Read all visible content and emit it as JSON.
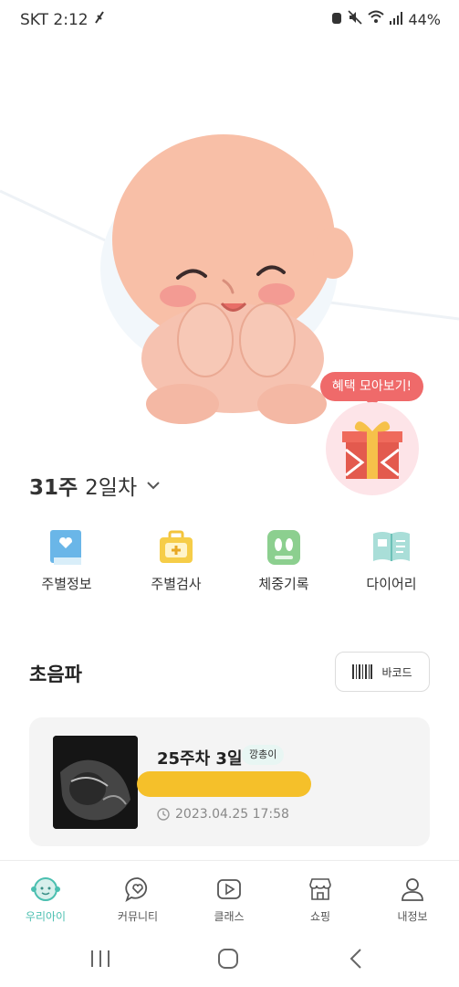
{
  "status_bar": {
    "carrier": "SKT",
    "time": "2:12",
    "battery": "44%"
  },
  "hero": {
    "gift_badge": "혜택 모아보기!"
  },
  "pregnancy": {
    "week": "31주",
    "day": "2일차"
  },
  "menu": {
    "items": [
      {
        "label": "주별정보",
        "icon": "book-heart-icon"
      },
      {
        "label": "주별검사",
        "icon": "medical-kit-icon"
      },
      {
        "label": "체중기록",
        "icon": "scale-icon"
      },
      {
        "label": "다이어리",
        "icon": "diary-icon"
      }
    ]
  },
  "ultrasound": {
    "title": "초음파",
    "barcode_button": "바코드",
    "card": {
      "week": "25주차 3일",
      "tag": "깡총이",
      "datetime": "2023.04.25 17:58"
    }
  },
  "bottom_nav": {
    "items": [
      {
        "label": "우리아이",
        "icon": "baby-face-icon",
        "active": true
      },
      {
        "label": "커뮤니티",
        "icon": "chat-heart-icon",
        "active": false
      },
      {
        "label": "클래스",
        "icon": "play-icon",
        "active": false
      },
      {
        "label": "쇼핑",
        "icon": "store-icon",
        "active": false
      },
      {
        "label": "내정보",
        "icon": "person-icon",
        "active": false
      }
    ]
  },
  "colors": {
    "accent": "#4bbfb0",
    "badge": "#ef6a6a",
    "highlight": "#f5c02a"
  }
}
